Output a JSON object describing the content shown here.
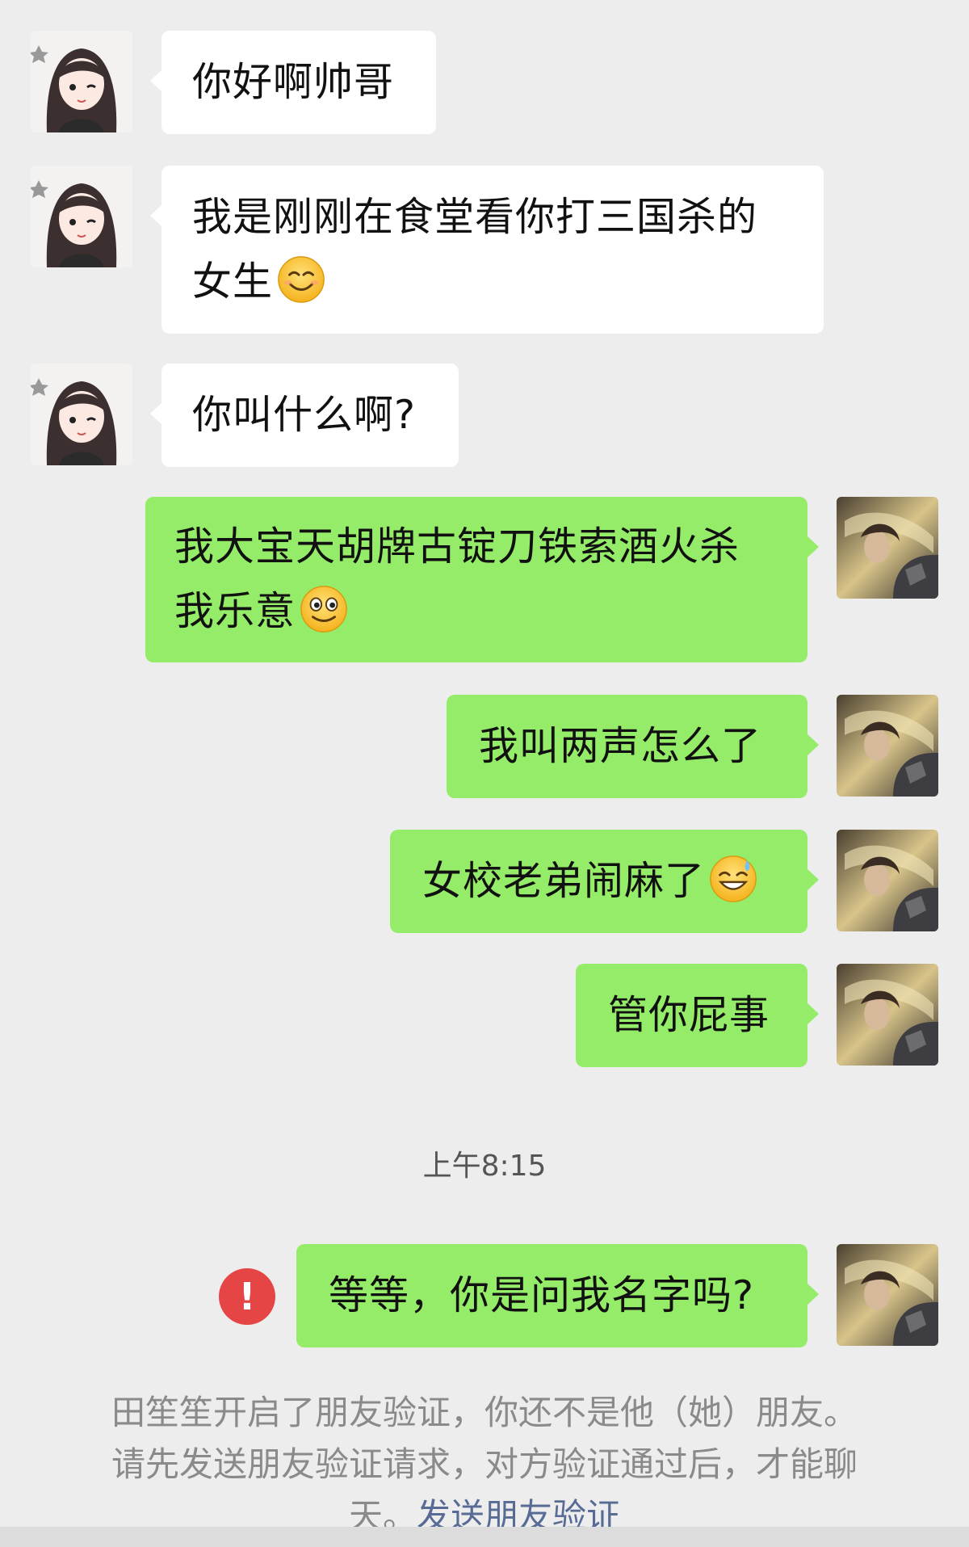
{
  "messages": [
    {
      "id": 1,
      "direction": "incoming",
      "avatar": "girl-anime-avatar",
      "lines": [
        "你好啊帅哥"
      ]
    },
    {
      "id": 2,
      "direction": "incoming",
      "avatar": "girl-anime-avatar",
      "lines": [
        "我是刚刚在食堂看你打三国杀的",
        "女生"
      ],
      "emoji": "smile-emoji"
    },
    {
      "id": 3,
      "direction": "incoming",
      "avatar": "girl-anime-avatar",
      "lines": [
        "你叫什么啊?"
      ]
    },
    {
      "id": 4,
      "direction": "outgoing",
      "avatar": "warrior-avatar",
      "lines": [
        "我大宝天胡牌古锭刀铁索酒火杀",
        "我乐意"
      ],
      "emoji": "grin-emoji"
    },
    {
      "id": 5,
      "direction": "outgoing",
      "avatar": "warrior-avatar",
      "lines": [
        "我叫两声怎么了"
      ]
    },
    {
      "id": 6,
      "direction": "outgoing",
      "avatar": "warrior-avatar",
      "lines": [
        "女校老弟闹麻了"
      ],
      "emoji": "sweat-smile-emoji"
    },
    {
      "id": 7,
      "direction": "outgoing",
      "avatar": "warrior-avatar",
      "lines": [
        "管你屁事"
      ]
    },
    {
      "id": 8,
      "direction": "outgoing",
      "avatar": "warrior-avatar",
      "lines": [
        "等等，你是问我名字吗?"
      ],
      "failed": true
    }
  ],
  "timestamp": "上午8:15",
  "error_icon_glyph": "!",
  "notice": {
    "line1": "田笙笙开启了朋友验证，你还不是他（她）朋友。",
    "line2": "请先发送朋友验证请求，对方验证通过后，才能聊",
    "line3_prefix": "天。",
    "link": "发送朋友验证"
  },
  "colors": {
    "background": "#ededed",
    "incoming_bubble": "#ffffff",
    "outgoing_bubble": "#95ec69",
    "error": "#e64545",
    "link": "#576b95"
  }
}
